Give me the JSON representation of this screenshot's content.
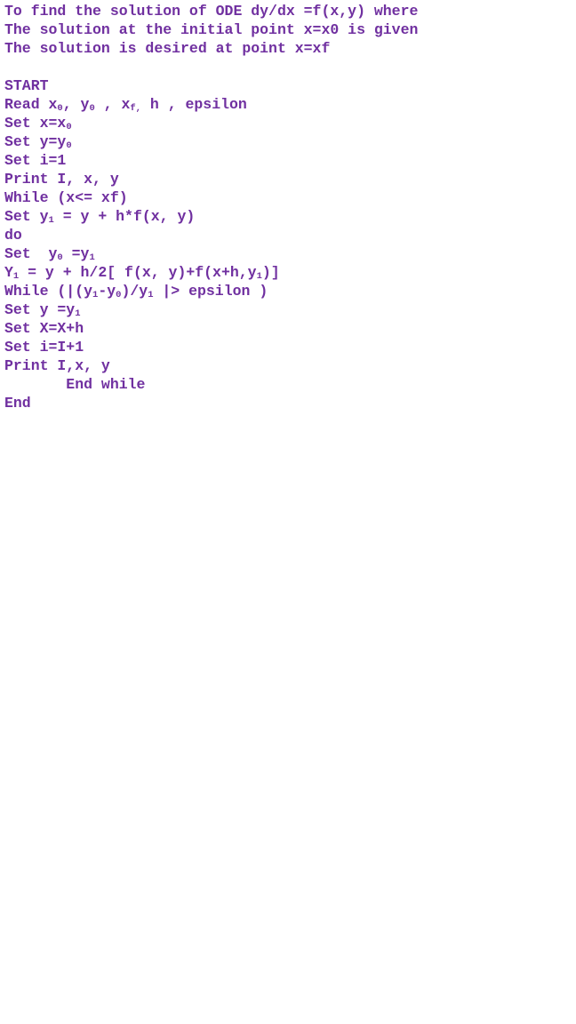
{
  "document": {
    "lines": [
      [
        {
          "t": "To find the solution of ODE dy/dx =f(x,y) where"
        }
      ],
      [
        {
          "t": "The solution at the initial point x=x0 is given"
        }
      ],
      [
        {
          "t": "The solution is desired at point x=xf"
        }
      ],
      [],
      [
        {
          "t": "START"
        }
      ],
      [
        {
          "t": "Read x"
        },
        {
          "t": "0",
          "sub": true
        },
        {
          "t": ", y"
        },
        {
          "t": "0",
          "sub": true
        },
        {
          "t": " , x"
        },
        {
          "t": "f,",
          "sub": true
        },
        {
          "t": " h , epsilon"
        }
      ],
      [
        {
          "t": "Set x=x"
        },
        {
          "t": "0",
          "sub": true
        }
      ],
      [
        {
          "t": "Set y=y"
        },
        {
          "t": "0",
          "sub": true
        }
      ],
      [
        {
          "t": "Set i=1"
        }
      ],
      [
        {
          "t": "Print I, x, y"
        }
      ],
      [
        {
          "t": "While (x<= xf)"
        }
      ],
      [
        {
          "t": "Set y"
        },
        {
          "t": "1",
          "sub": true
        },
        {
          "t": " = y + h*f(x, y)"
        }
      ],
      [
        {
          "t": "do"
        }
      ],
      [
        {
          "t": "Set  y"
        },
        {
          "t": "0",
          "sub": true
        },
        {
          "t": " =y"
        },
        {
          "t": "1",
          "sub": true
        }
      ],
      [
        {
          "t": "Y"
        },
        {
          "t": "1",
          "sub": true
        },
        {
          "t": " = y + h/2[ f(x, y)+f(x+h,y"
        },
        {
          "t": "1",
          "sub": true
        },
        {
          "t": ")]"
        }
      ],
      [
        {
          "t": "While (|(y"
        },
        {
          "t": "1",
          "sub": true
        },
        {
          "t": "-y"
        },
        {
          "t": "0",
          "sub": true
        },
        {
          "t": ")/y"
        },
        {
          "t": "1",
          "sub": true
        },
        {
          "t": " |> epsilon )"
        }
      ],
      [
        {
          "t": "Set y =y"
        },
        {
          "t": "1",
          "sub": true
        }
      ],
      [
        {
          "t": "Set X=X+h"
        }
      ],
      [
        {
          "t": "Set i=I+1"
        }
      ],
      [
        {
          "t": "Print I,x, y"
        }
      ],
      [
        {
          "t": "       End while"
        }
      ],
      [
        {
          "t": "End"
        }
      ]
    ]
  },
  "colors": {
    "text": "#7030A0",
    "background": "#ffffff"
  }
}
